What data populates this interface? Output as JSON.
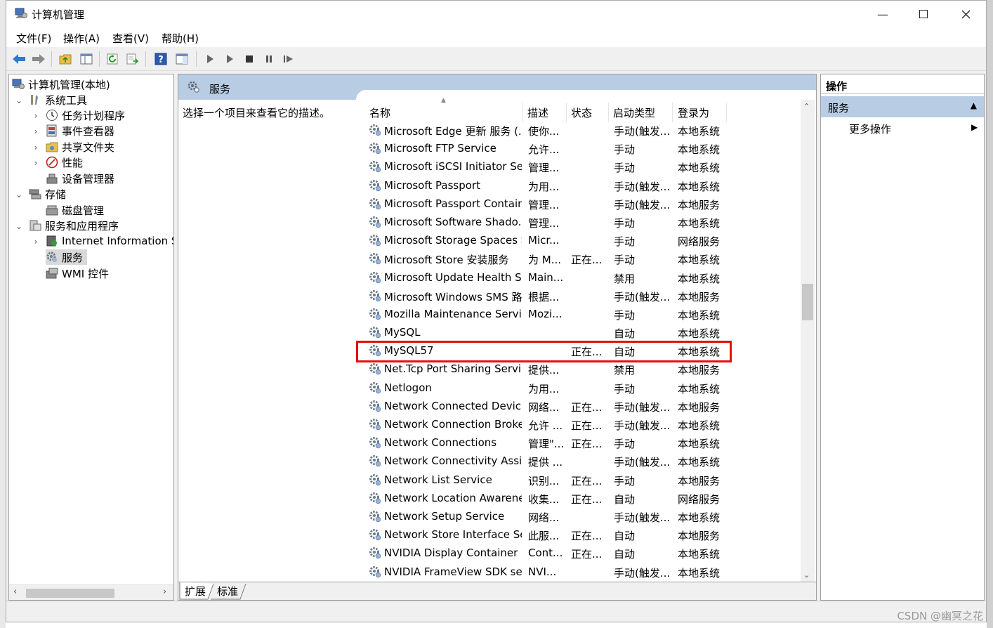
{
  "window": {
    "title": "计算机管理"
  },
  "menu": [
    "文件(F)",
    "操作(A)",
    "查看(V)",
    "帮助(H)"
  ],
  "tree": {
    "root": "计算机管理(本地)",
    "items": [
      "系统工具",
      "任务计划程序",
      "事件查看器",
      "共享文件夹",
      "性能",
      "设备管理器",
      "存储",
      "磁盘管理",
      "服务和应用程序",
      "Internet Information Se",
      "服务",
      "WMI 控件"
    ]
  },
  "center": {
    "header_title": "服务",
    "description_hint": "选择一个项目来查看它的描述。",
    "columns": [
      "名称",
      "描述",
      "状态",
      "启动类型",
      "登录为"
    ],
    "rows": [
      [
        "Microsoft Edge 更新 服务 (...",
        "使你...",
        "",
        "手动(触发...",
        "本地系统"
      ],
      [
        "Microsoft FTP Service",
        "允许...",
        "",
        "手动",
        "本地系统"
      ],
      [
        "Microsoft iSCSI Initiator Ser...",
        "管理...",
        "",
        "手动",
        "本地系统"
      ],
      [
        "Microsoft Passport",
        "为用...",
        "",
        "手动(触发...",
        "本地系统"
      ],
      [
        "Microsoft Passport Container",
        "管理...",
        "",
        "手动(触发...",
        "本地服务"
      ],
      [
        "Microsoft Software Shado...",
        "管理...",
        "",
        "手动",
        "本地系统"
      ],
      [
        "Microsoft Storage Spaces S...",
        "Micr...",
        "",
        "手动",
        "网络服务"
      ],
      [
        "Microsoft Store 安装服务",
        "为 M...",
        "正在...",
        "手动",
        "本地系统"
      ],
      [
        "Microsoft Update Health S...",
        "Main...",
        "",
        "禁用",
        "本地系统"
      ],
      [
        "Microsoft Windows SMS 路...",
        "根据...",
        "",
        "手动(触发...",
        "本地服务"
      ],
      [
        "Mozilla Maintenance Service",
        "Mozi...",
        "",
        "手动",
        "本地系统"
      ],
      [
        "MySQL",
        "",
        "",
        "自动",
        "本地系统"
      ],
      [
        "MySQL57",
        "",
        "正在...",
        "自动",
        "本地系统"
      ],
      [
        "Net.Tcp Port Sharing Service",
        "提供...",
        "",
        "禁用",
        "本地服务"
      ],
      [
        "Netlogon",
        "为用...",
        "",
        "手动",
        "本地系统"
      ],
      [
        "Network Connected Devic...",
        "网络...",
        "正在...",
        "手动(触发...",
        "本地服务"
      ],
      [
        "Network Connection Broker",
        "允许 ...",
        "正在...",
        "手动(触发...",
        "本地系统"
      ],
      [
        "Network Connections",
        "管理\"...",
        "正在...",
        "手动",
        "本地系统"
      ],
      [
        "Network Connectivity Assis...",
        "提供 ...",
        "",
        "手动(触发...",
        "本地系统"
      ],
      [
        "Network List Service",
        "识别...",
        "正在...",
        "手动",
        "本地服务"
      ],
      [
        "Network Location Awarene...",
        "收集...",
        "正在...",
        "自动",
        "网络服务"
      ],
      [
        "Network Setup Service",
        "网络...",
        "",
        "手动(触发...",
        "本地系统"
      ],
      [
        "Network Store Interface Se...",
        "此服...",
        "正在...",
        "自动",
        "本地服务"
      ],
      [
        "NVIDIA Display Container LS",
        "Cont...",
        "正在...",
        "自动",
        "本地系统"
      ],
      [
        "NVIDIA FrameView SDK se...",
        "NVI...",
        "",
        "手动(触发...",
        "本地系统"
      ]
    ],
    "tabs": [
      "扩展",
      "标准"
    ]
  },
  "actions": {
    "title": "操作",
    "section": "服务",
    "item": "更多操作"
  },
  "watermark": "CSDN @幽冥之花",
  "colors": {
    "header_blue": "#b8cce4",
    "highlight_red": "#e41010"
  }
}
